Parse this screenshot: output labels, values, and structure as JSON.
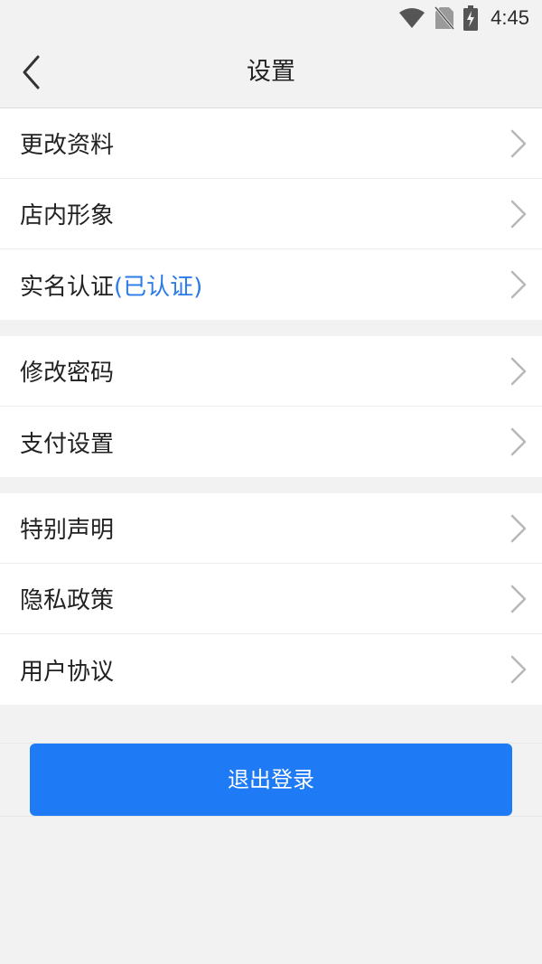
{
  "status_bar": {
    "time": "4:45",
    "icons": [
      "wifi-icon",
      "no-sim-icon",
      "battery-charging-icon"
    ]
  },
  "header": {
    "title": "设置",
    "back_icon": "chevron-left-icon"
  },
  "groups": [
    {
      "items": [
        {
          "label": "更改资料"
        },
        {
          "label": "店内形象"
        },
        {
          "label": "实名认证",
          "note": "(已认证)",
          "note_color": "#2b7be8"
        }
      ]
    },
    {
      "items": [
        {
          "label": "修改密码"
        },
        {
          "label": "支付设置"
        }
      ]
    },
    {
      "items": [
        {
          "label": "特别声明"
        },
        {
          "label": "隐私政策"
        },
        {
          "label": "用户协议"
        }
      ]
    }
  ],
  "logout": {
    "label": "退出登录",
    "color": "#1e7bf5"
  }
}
